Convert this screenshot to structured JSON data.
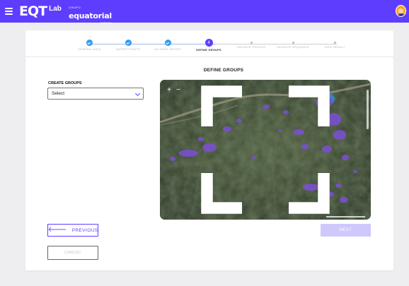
{
  "app": {
    "brand_main": "EQT",
    "brand_sup": "Lab",
    "partner_small": "GRUPO",
    "partner_name": "equatorial",
    "partner_sub": "ENERGIA"
  },
  "stepper": {
    "steps": [
      {
        "label": "GENERAL DATA",
        "state": "done"
      },
      {
        "label": "IMPORT POINTS",
        "state": "done"
      },
      {
        "label": "VALIDATE IMPORT",
        "state": "done"
      },
      {
        "label": "DEFINE GROUPS",
        "state": "active",
        "number": "4"
      },
      {
        "label": "VALIDATE GROUPS",
        "state": "todo"
      },
      {
        "label": "VALIDATE SEQUENCE",
        "state": "todo"
      },
      {
        "label": "VIEW RESULT",
        "state": "todo"
      }
    ]
  },
  "main": {
    "heading": "DEFINE GROUPS",
    "create_groups_label": "CREATE GROUPS",
    "select_value": "Select"
  },
  "map": {
    "zoom_in": "+",
    "zoom_out": "−",
    "point_color": "#7b4fd6",
    "water_color": "#3a86d9"
  },
  "actions": {
    "previous_label": "PREVIOUS",
    "previous_arrow": "🡐",
    "next_label": "NEXT",
    "cancel_label": "CANCEL"
  },
  "colors": {
    "primary": "#5f3dff",
    "step_done": "#2f9bf0",
    "next_disabled": "#cfc8fb"
  }
}
